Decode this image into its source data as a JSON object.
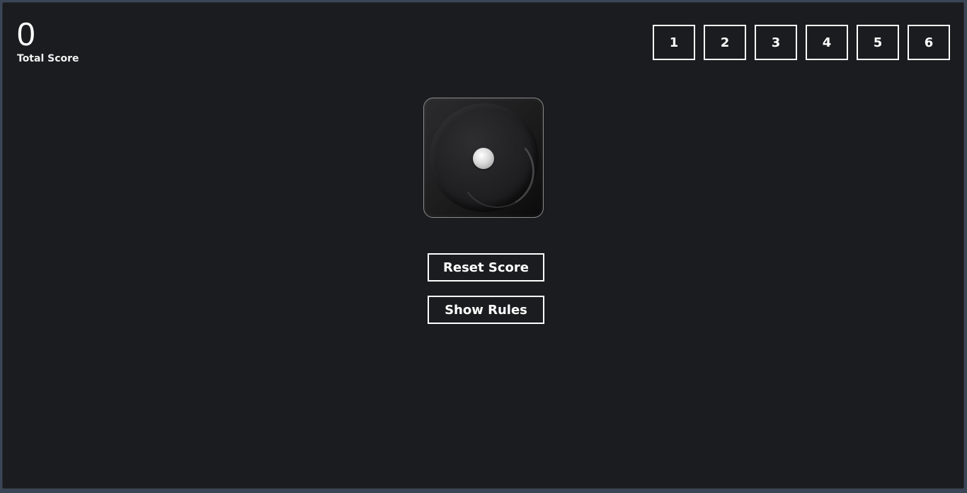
{
  "score": {
    "value": "0",
    "label": "Total Score"
  },
  "target_buttons": [
    "1",
    "2",
    "3",
    "4",
    "5",
    "6"
  ],
  "die": {
    "face": 1,
    "icon": "die-face-one-icon"
  },
  "actions": {
    "reset_label": "Reset Score",
    "rules_label": "Show Rules"
  },
  "colors": {
    "background": "#1b1c1f",
    "outer_frame": "#3a4556",
    "text": "#ffffff",
    "button_border": "#ffffff"
  }
}
